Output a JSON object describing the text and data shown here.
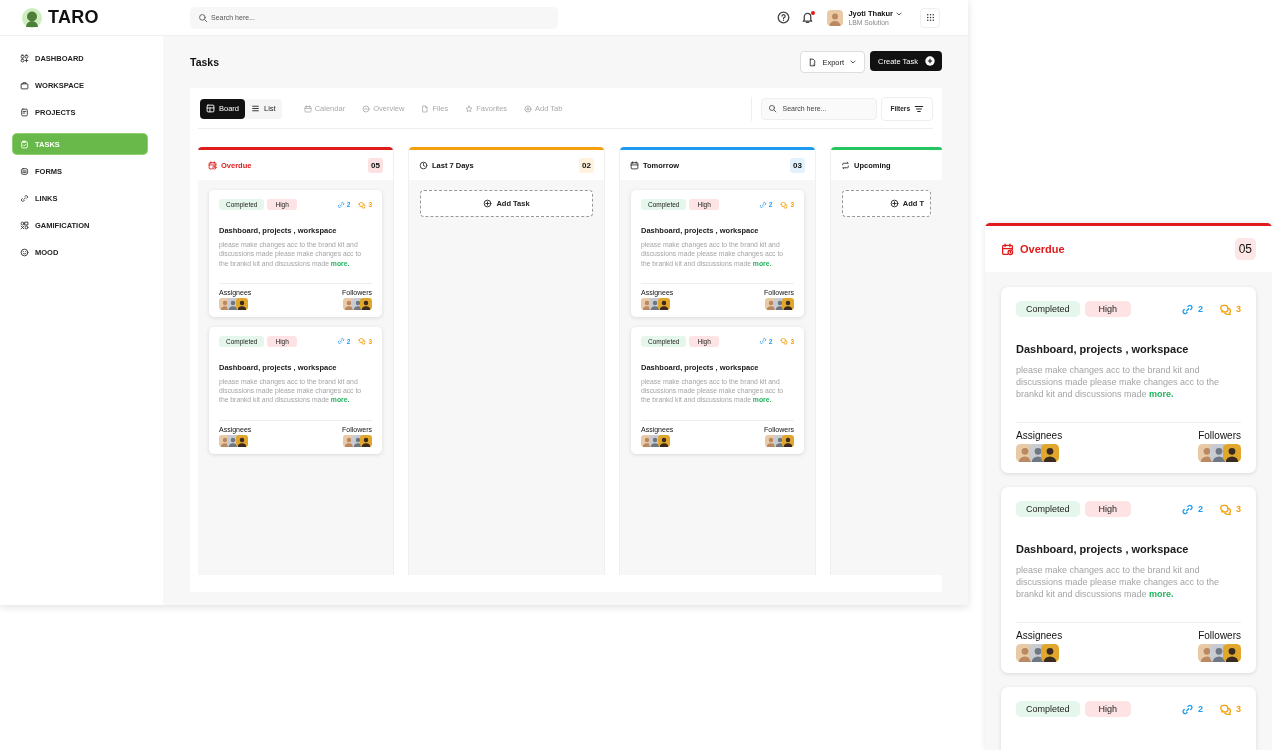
{
  "header": {
    "logo": "TARO",
    "search": {
      "placeholder": "Search here..."
    },
    "notifications": {
      "unread": true
    },
    "user": {
      "name": "Jyoti Thakur",
      "company": "LBM Solution"
    }
  },
  "sidebar": {
    "items": [
      {
        "label": "DASHBOARD",
        "selected": false
      },
      {
        "label": "WORKSPACE",
        "selected": false
      },
      {
        "label": "PROJECTS",
        "selected": false
      },
      {
        "label": "TASKS",
        "selected": true
      },
      {
        "label": "FORMS",
        "selected": false
      },
      {
        "label": "LINKS",
        "selected": false
      },
      {
        "label": "GAMIFICATION",
        "selected": false
      },
      {
        "label": "MOOD",
        "selected": false
      }
    ]
  },
  "page": {
    "title": "Tasks",
    "export_button": "Export",
    "create_button": "Create Task"
  },
  "view_tabs": [
    {
      "label": "Board",
      "selected": true
    },
    {
      "label": "List",
      "selected": false
    }
  ],
  "tabs": [
    "Calendar",
    "Overview",
    "Files",
    "Favorites",
    "Add Tab"
  ],
  "board_search": {
    "placeholder": "Search here..."
  },
  "filters_button": "Filters",
  "columns": [
    {
      "title": "Overdue",
      "count": "05",
      "color": "#e01b1b",
      "alert": true,
      "cards": [
        {
          "tags": [
            {
              "label": "Completed",
              "kind": "status"
            },
            {
              "label": "High",
              "kind": "priority"
            }
          ],
          "links": "2",
          "comments": "3",
          "title": "Dashboard, projects , workspace",
          "description": "please make changes acc to the brand kit and discussions made please make changes acc to the brankd kit and discussions made",
          "more": "more.",
          "assignees_label": "Assignees",
          "followers_label": "Followers"
        },
        {
          "tags": [
            {
              "label": "Completed",
              "kind": "status"
            },
            {
              "label": "High",
              "kind": "priority"
            }
          ],
          "links": "2",
          "comments": "3",
          "title": "Dashboard, projects , workspace",
          "description": "please make changes acc to the brand kit and discussions made please make changes acc to the brankd kit and discussions made",
          "more": "more.",
          "assignees_label": "Assignees",
          "followers_label": "Followers"
        }
      ]
    },
    {
      "title": "Last 7 Days",
      "count": "02",
      "color": "#f5a00a",
      "alert": false,
      "add_task": "Add Task"
    },
    {
      "title": "Tomorrow",
      "count": "03",
      "color": "#1c9bf0",
      "alert": false,
      "cards": [
        {
          "tags": [
            {
              "label": "Completed",
              "kind": "status"
            },
            {
              "label": "High",
              "kind": "priority"
            }
          ],
          "links": "2",
          "comments": "3",
          "title": "Dashboard, projects , workspace",
          "description": "please make changes acc to the brand kit and discussions made please make changes acc to the brankd kit and discussions made",
          "more": "more.",
          "assignees_label": "Assignees",
          "followers_label": "Followers"
        },
        {
          "tags": [
            {
              "label": "Completed",
              "kind": "status"
            },
            {
              "label": "High",
              "kind": "priority"
            }
          ],
          "links": "2",
          "comments": "3",
          "title": "Dashboard, projects , workspace",
          "description": "please make changes acc to the brand kit and discussions made please make changes acc to the brankd kit and discussions made",
          "more": "more.",
          "assignees_label": "Assignees",
          "followers_label": "Followers"
        }
      ]
    },
    {
      "title": "Upcoming",
      "color": "#22c55e",
      "alert": false,
      "add_task": "Add T"
    }
  ],
  "detail": {
    "title": "Overdue",
    "count": "05",
    "color": "#e01b1b",
    "cards": [
      {
        "tags": [
          {
            "label": "Completed",
            "kind": "status"
          },
          {
            "label": "High",
            "kind": "priority"
          }
        ],
        "links": "2",
        "comments": "3",
        "title": "Dashboard, projects , workspace",
        "description": "please make changes acc to the brand kit and discussions made please make changes acc to the brankd kit and discussions made",
        "more": "more.",
        "assignees_label": "Assignees",
        "followers_label": "Followers"
      },
      {
        "tags": [
          {
            "label": "Completed",
            "kind": "status"
          },
          {
            "label": "High",
            "kind": "priority"
          }
        ],
        "links": "2",
        "comments": "3",
        "title": "Dashboard, projects , workspace",
        "description": "please make changes acc to the brand kit and discussions made please make changes acc to the brankd kit and discussions made",
        "more": "more.",
        "assignees_label": "Assignees",
        "followers_label": "Followers"
      },
      {
        "tags": [
          {
            "label": "Completed",
            "kind": "status"
          },
          {
            "label": "High",
            "kind": "priority"
          }
        ],
        "links": "2",
        "comments": "3"
      }
    ]
  }
}
